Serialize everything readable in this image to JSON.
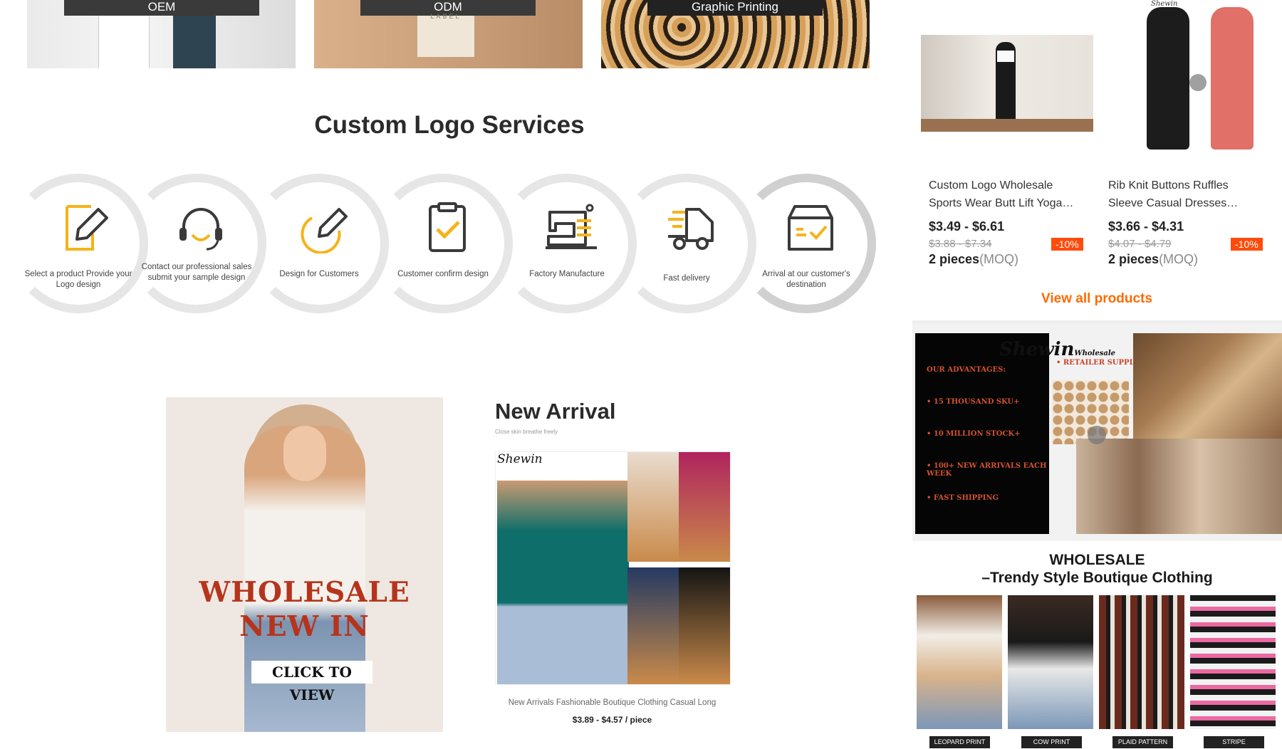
{
  "tiles": [
    {
      "label": "OEM"
    },
    {
      "label": "ODM",
      "sublabel": "LABEL"
    },
    {
      "label": "Graphic Printing"
    }
  ],
  "logo_services": {
    "title": "Custom Logo Services",
    "steps": [
      {
        "icon": "edit-icon",
        "label": "Select a product Provide your Logo design"
      },
      {
        "icon": "headset-icon",
        "label": "Contact our professional sales submit your sample design"
      },
      {
        "icon": "pencil-circle-icon",
        "label": "Design for Customers"
      },
      {
        "icon": "clipboard-check-icon",
        "label": "Customer confirm design"
      },
      {
        "icon": "sewing-machine-icon",
        "label": "Factory Manufacture"
      },
      {
        "icon": "delivery-truck-icon",
        "label": "Fast delivery"
      },
      {
        "icon": "box-check-icon",
        "label": "Arrival at our customer's destination"
      }
    ]
  },
  "products": [
    {
      "title_line1": "Custom Logo Wholesale",
      "title_line2": "Sports Wear Butt Lift Yoga…",
      "price": "$3.49 - $6.61",
      "old_price": "$3.88 - $7.34",
      "moq": "2 pieces",
      "moq_label": "(MOQ)",
      "discount": "-10%"
    },
    {
      "title_line1": "Rib Knit Buttons Ruffles",
      "title_line2": "Sleeve Casual Dresses…",
      "price": "$3.66 - $4.31",
      "old_price": "$4.07 - $4.79",
      "moq": "2 pieces",
      "moq_label": "(MOQ)",
      "discount": "-10%"
    }
  ],
  "p2_brand": "Shewin",
  "view_all": "View all products",
  "banner": {
    "brand": "Shewin",
    "brand_small": "Wholesale",
    "sub": "• RETAILER SUPPLIER",
    "advantages_title": "OUR ADVANTAGES:",
    "advantages": [
      "• 15 THOUSAND SKU+",
      "• 10 MILLION STOCK+",
      "• 100+ NEW ARRIVALS EACH WEEK",
      "• FAST SHIPPING"
    ]
  },
  "wholesale": {
    "title_line1": "WHOLESALE",
    "title_line2": "–Trendy Style Boutique Clothing",
    "tags": [
      "LEOPARD PRINT",
      "COW PRINT",
      "PLAID PATTERN",
      "STRIPE"
    ]
  },
  "new_in": {
    "line1": "WHOLESALE",
    "line2": "NEW IN",
    "button": "CLICK TO VIEW"
  },
  "new_arrival": {
    "title": "New Arrival",
    "subtitle": "Close skin breathe freely",
    "brand": "Shewin",
    "caption": "New Arrivals Fashionable Boutique Clothing Casual Long",
    "price": "$3.89 - $4.57 / piece"
  },
  "colors": {
    "accent": "#ff6a00",
    "discount": "#ff4c0c",
    "icon_yellow": "#f5b31a",
    "icon_dark": "#3a3a3a"
  }
}
